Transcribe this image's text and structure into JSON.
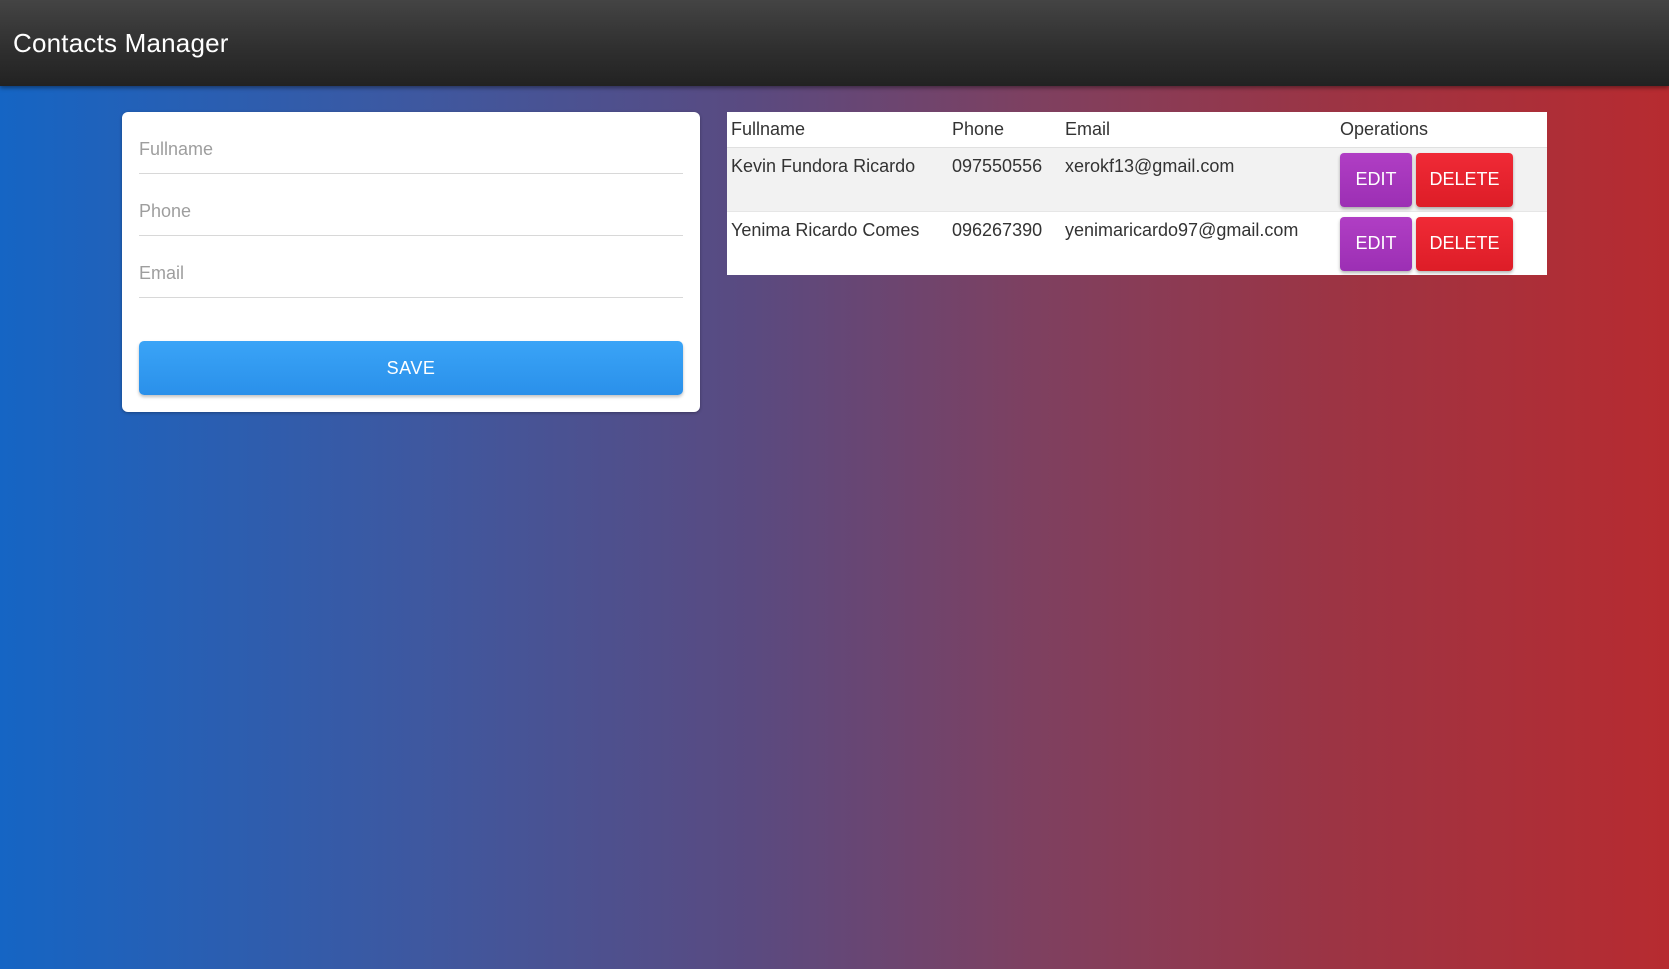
{
  "app": {
    "title": "Contacts Manager"
  },
  "form": {
    "fullname_placeholder": "Fullname",
    "fullname_value": "",
    "phone_placeholder": "Phone",
    "phone_value": "",
    "email_placeholder": "Email",
    "email_value": "",
    "save_label": "SAVE"
  },
  "table": {
    "headers": [
      "Fullname",
      "Phone",
      "Email",
      "Operations"
    ],
    "rows": [
      {
        "fullname": "Kevin Fundora Ricardo",
        "phone": "097550556",
        "email": "xerokf13@gmail.com",
        "edit_label": "EDIT",
        "delete_label": "DELETE"
      },
      {
        "fullname": "Yenima Ricardo Comes",
        "phone": "096267390",
        "email": "yenimaricardo97@gmail.com",
        "edit_label": "EDIT",
        "delete_label": "DELETE"
      }
    ]
  },
  "colors": {
    "topbar": "#2e2e2e",
    "save_button": "#2a90ea",
    "edit_button": "#9c2fb4",
    "delete_button": "#dd1d27",
    "gradient_left": "#1565c4",
    "gradient_right": "#b72b30"
  }
}
